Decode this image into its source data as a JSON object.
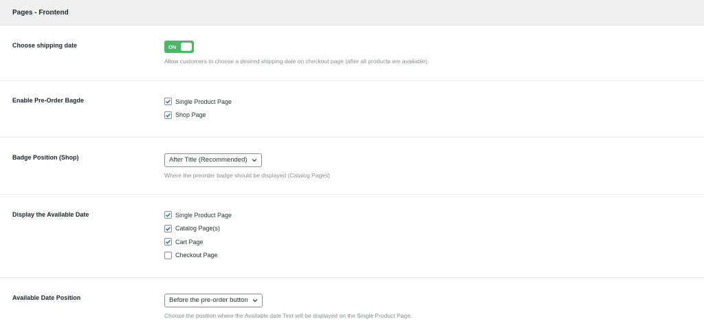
{
  "section": {
    "title": "Pages - Frontend"
  },
  "shipping": {
    "label": "Choose shipping date",
    "toggle_text": "ON",
    "toggle_on": true,
    "description": "Allow customers to choose a desired shipping date on checkout page (after all products are available)."
  },
  "badge": {
    "label": "Enable Pre-Order Bagde",
    "options": [
      {
        "label": "Single Product Page",
        "checked": true
      },
      {
        "label": "Shop Page",
        "checked": true
      }
    ]
  },
  "badge_position": {
    "label": "Badge Position (Shop)",
    "selected": "After Title (Recommended)",
    "description": "Where the preorder badge should be displayed (Catalog Pages)"
  },
  "available_date": {
    "label": "Display the Available Date",
    "options": [
      {
        "label": "Single Product Page",
        "checked": true
      },
      {
        "label": "Catalog Page(s)",
        "checked": true
      },
      {
        "label": "Cart Page",
        "checked": true
      },
      {
        "label": "Checkout Page",
        "checked": false
      }
    ]
  },
  "date_position": {
    "label": "Available Date Position",
    "selected": "Before the pre-order button",
    "description": "Choose the position where the Available date Text will be displayed on the Single Product Page."
  },
  "colors": {
    "toggle_on": "#4ab866",
    "checkmark": "#2271b1"
  }
}
